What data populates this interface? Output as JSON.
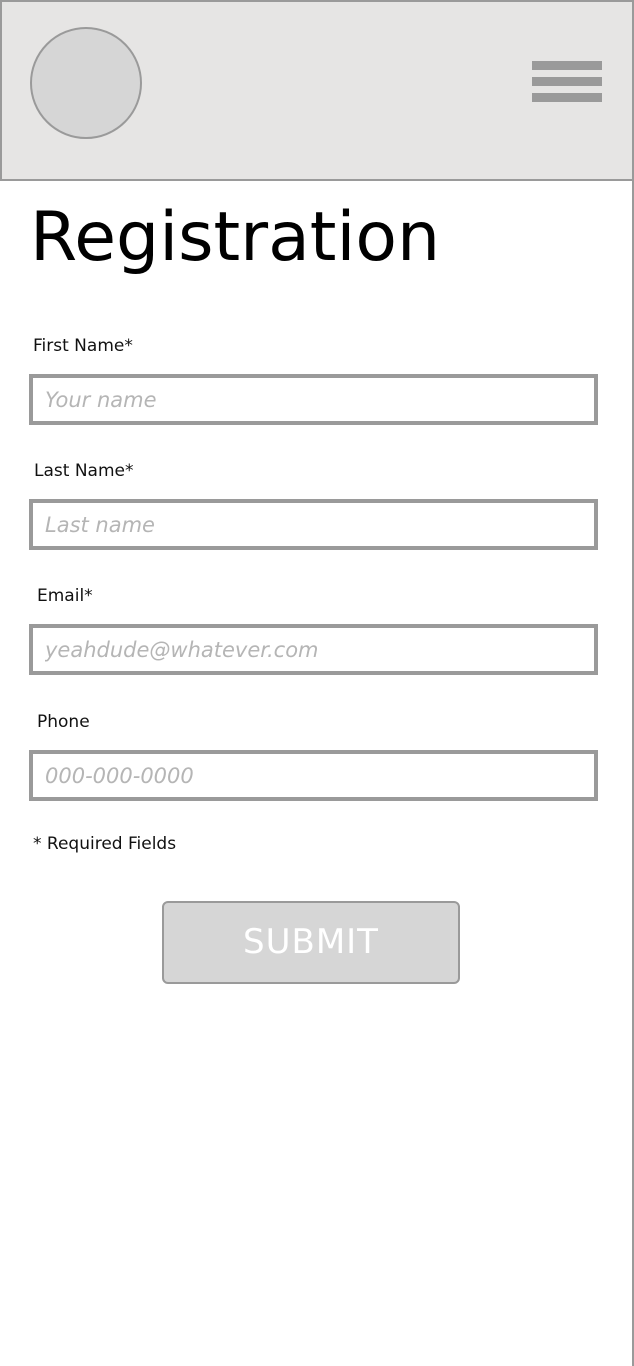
{
  "header": {
    "logo_icon": "avatar-circle",
    "menu_icon": "hamburger-menu-icon"
  },
  "page": {
    "title": "Registration"
  },
  "form": {
    "first_name": {
      "label": "First Name*",
      "placeholder": "Your name",
      "value": ""
    },
    "last_name": {
      "label": "Last Name*",
      "placeholder": "Last name",
      "value": ""
    },
    "email": {
      "label": "Email*",
      "placeholder": "yeahdude@whatever.com",
      "value": ""
    },
    "phone": {
      "label": "Phone",
      "placeholder": "000-000-0000",
      "value": ""
    },
    "required_note": "* Required Fields",
    "submit_label": "SUBMIT"
  },
  "colors": {
    "header_bg": "#e6e5e4",
    "border_gray": "#9a9a9a",
    "placeholder_gray": "#b5b5b5",
    "button_bg": "#d6d6d6",
    "button_text": "#ffffff"
  }
}
